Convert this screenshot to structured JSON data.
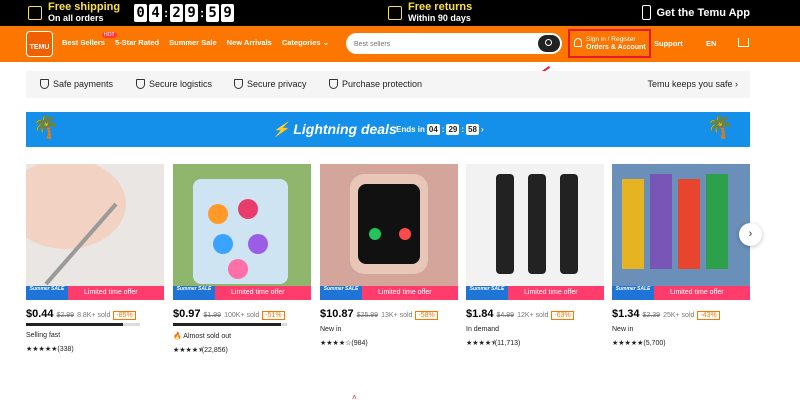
{
  "promo": {
    "free_shipping_title": "Free shipping",
    "free_shipping_sub": "On all orders",
    "countdown": [
      "0",
      "4",
      ":",
      "2",
      "9",
      ":",
      "5",
      "9"
    ],
    "free_returns_title": "Free returns",
    "free_returns_sub": "Within 90 days",
    "app_label": "Get the Temu App"
  },
  "nav": {
    "logo": "TEMU",
    "links": [
      "Best Sellers",
      "5-Star Rated",
      "Summer Sale",
      "New Arrivals",
      "Categories ⌄"
    ],
    "hot_badge": "HOT",
    "search_placeholder": "Best sellers",
    "signin_line1": "Sign in / Register",
    "signin_line2": "Orders & Account",
    "support": "Support",
    "language": "EN"
  },
  "trust": {
    "items": [
      "Safe payments",
      "Secure logistics",
      "Secure privacy",
      "Purchase protection"
    ],
    "keeps": "Temu keeps you safe ›"
  },
  "banner": {
    "title": "⚡ Lightning deals",
    "ends_label": "Ends in",
    "timer": [
      "04",
      "29",
      "58"
    ]
  },
  "sale": {
    "badge": "Summer SALE",
    "limited": "Limited time offer"
  },
  "products": [
    {
      "price": "$0.44",
      "old": "$2.99",
      "sold": "8.8K+ sold",
      "discount": "-85%",
      "sold_ratio": 0.85,
      "tag": "Selling fast",
      "rating": "★★★★★(338)",
      "color": "#e9e6e3"
    },
    {
      "price": "$0.97",
      "old": "$1.99",
      "sold": "100K+ sold",
      "discount": "-51%",
      "sold_ratio": 0.95,
      "tag": "🔥 Almost sold out",
      "rating": "★★★★⯨(22,856)",
      "color": "#8fb66d"
    },
    {
      "price": "$10.87",
      "old": "$25.99",
      "sold": "13K+ sold",
      "discount": "-58%",
      "sold_ratio": 0.0,
      "tag": "New in",
      "rating": "★★★★☆(984)",
      "color": "#d4a59b"
    },
    {
      "price": "$1.84",
      "old": "$4.99",
      "sold": "12K+ sold",
      "discount": "-63%",
      "sold_ratio": 0.0,
      "tag": "In demand",
      "rating": "★★★★⯨(11,713)",
      "color": "#f2f2f2"
    },
    {
      "price": "$1.34",
      "old": "$2.39",
      "sold": "25K+ sold",
      "discount": "-43%",
      "sold_ratio": 0.0,
      "tag": "New in",
      "rating": "★★★★★(5,700)",
      "color": "#6a8fb8"
    }
  ],
  "next_label": "›"
}
